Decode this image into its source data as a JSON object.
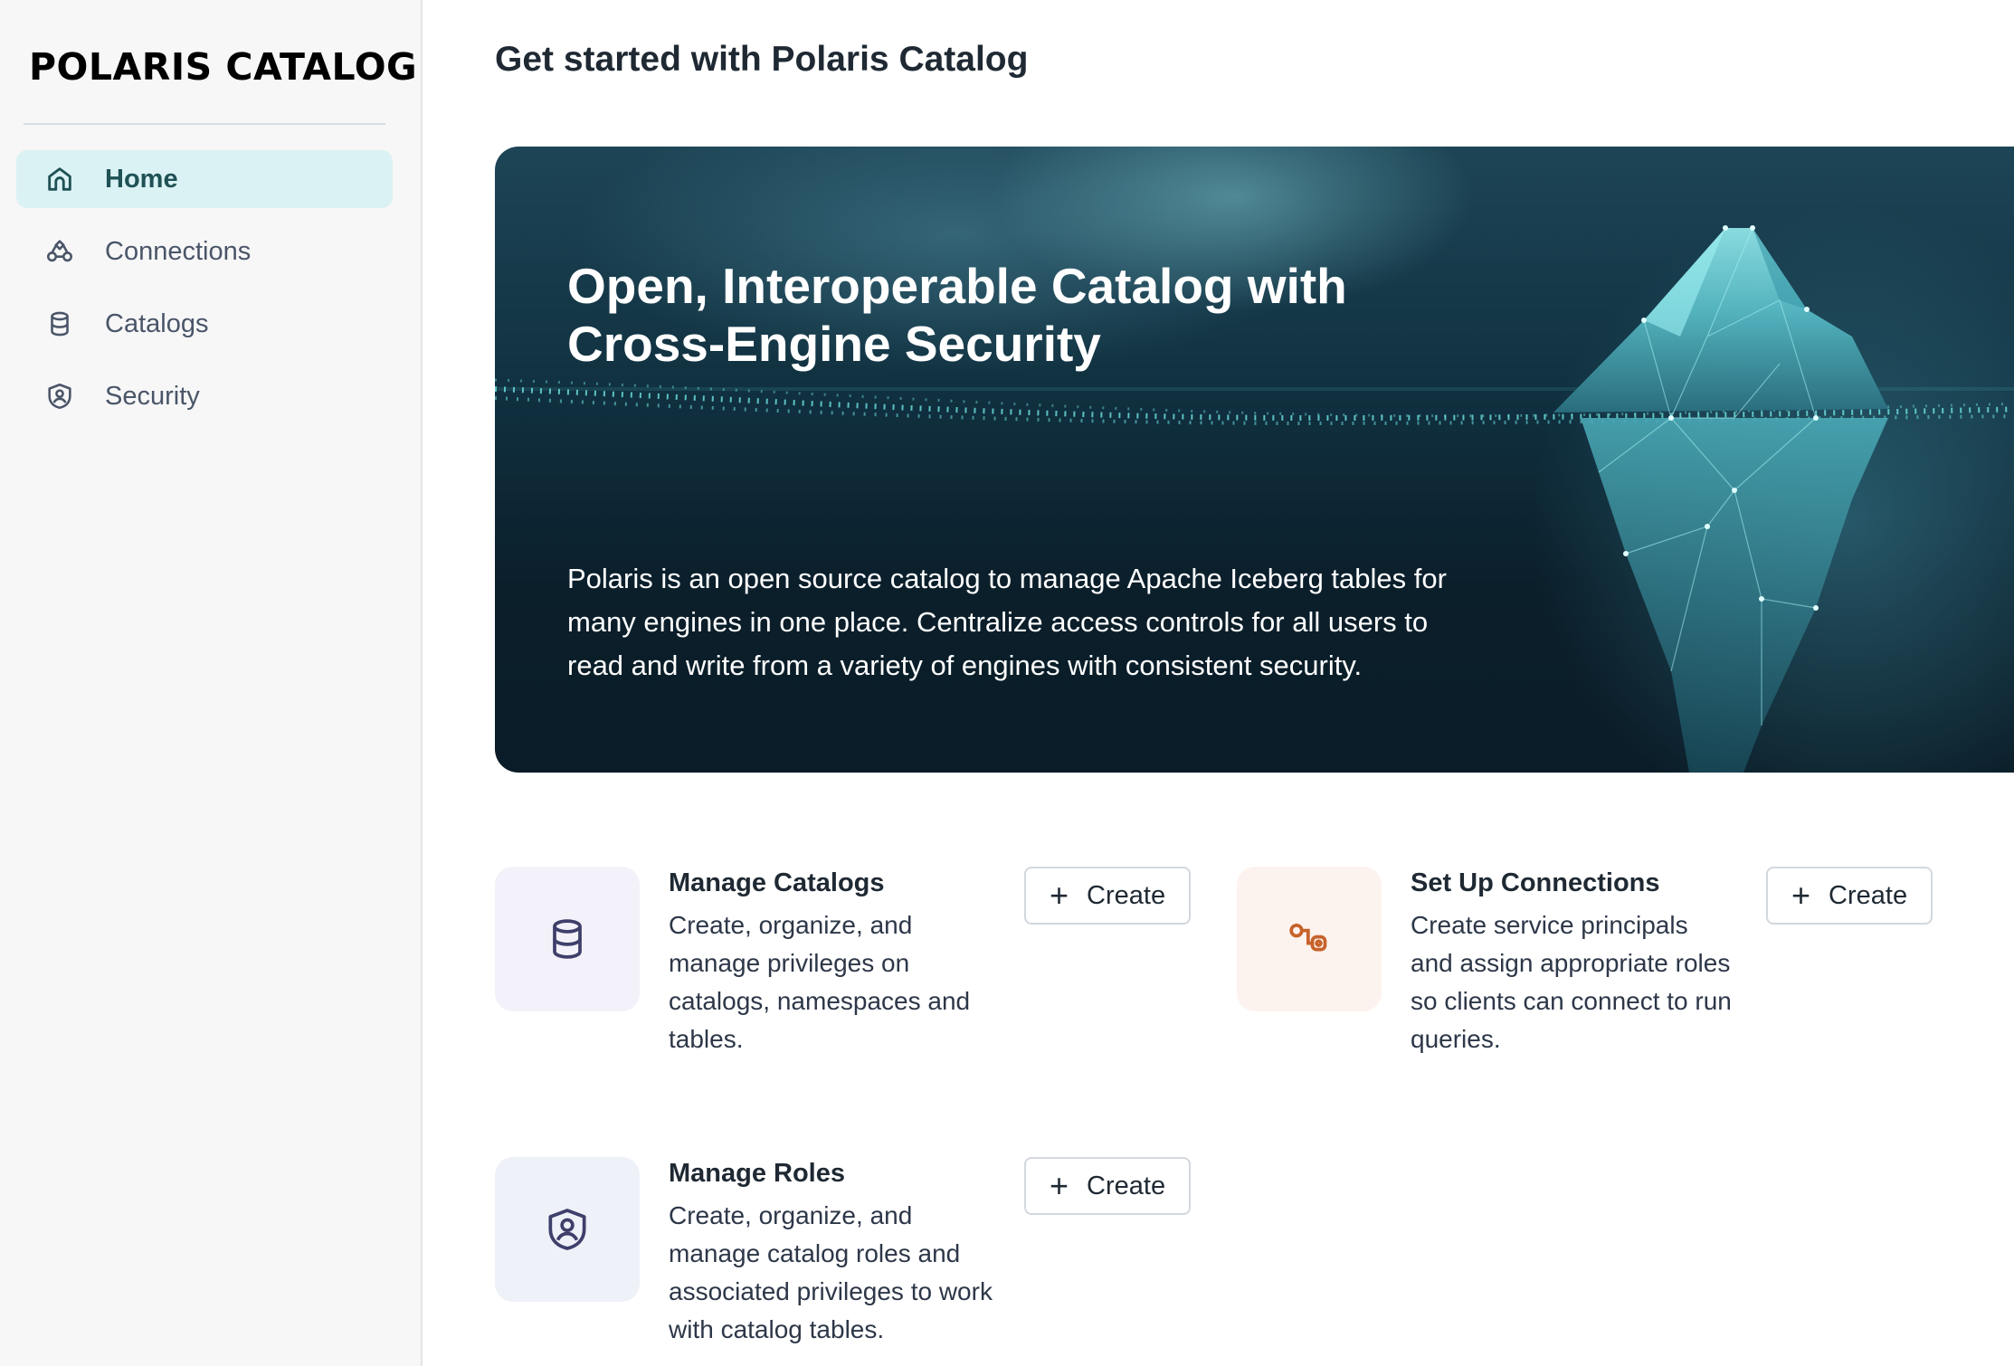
{
  "sidebar": {
    "logo": "POLARIS CATALOG",
    "items": [
      {
        "label": "Home",
        "icon": "home-icon",
        "active": true
      },
      {
        "label": "Connections",
        "icon": "connections-icon",
        "active": false
      },
      {
        "label": "Catalogs",
        "icon": "database-icon",
        "active": false
      },
      {
        "label": "Security",
        "icon": "shield-user-icon",
        "active": false
      }
    ]
  },
  "main": {
    "title": "Get started with Polaris Catalog",
    "hero": {
      "title": "Open, Interoperable Catalog with Cross-Engine Security",
      "description": "Polaris is an open source catalog to manage Apache Iceberg tables for many engines in one place. Centralize access controls for all users to read and write from a variety of engines with consistent security."
    },
    "cards": [
      {
        "title": "Manage Catalogs",
        "description": "Create, organize, and manage privileges on catalogs, namespaces and tables.",
        "button": "Create",
        "icon": "database-icon",
        "icon_bg": "#f3f1f9",
        "icon_color": "#3e3f6b"
      },
      {
        "title": "Set Up Connections",
        "description": "Create service principals and assign appropriate roles so clients can connect to run queries.",
        "button": "Create",
        "icon": "connection-icon",
        "icon_bg": "#fdf3ee",
        "icon_color": "#c7622a"
      },
      {
        "title": "Manage Roles",
        "description": "Create, organize, and manage catalog roles and associated privileges to work with catalog tables.",
        "button": "Create",
        "icon": "shield-user-icon",
        "icon_bg": "#eef1f8",
        "icon_color": "#3e3f6b"
      }
    ]
  },
  "colors": {
    "accent": "#dbf2f4",
    "sidebar_bg": "#f7f7f8"
  }
}
